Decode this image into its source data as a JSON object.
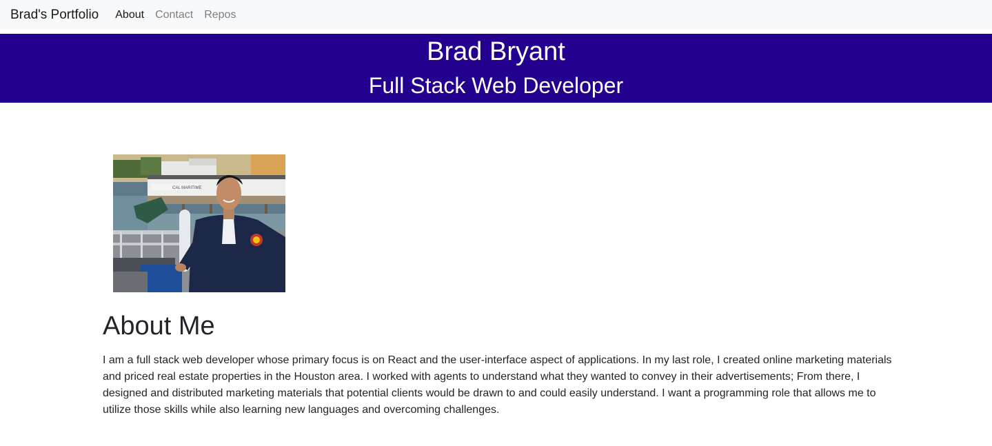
{
  "navbar": {
    "brand": "Brad's Portfolio",
    "links": [
      "About",
      "Contact",
      "Repos"
    ],
    "active": "About"
  },
  "hero": {
    "name": "Brad Bryant",
    "title": "Full Stack Web Developer",
    "background_color": "#24008f"
  },
  "photo": {
    "sign_text": "CAL MARITIME"
  },
  "about": {
    "heading": "About Me",
    "body": "I am a full stack web developer whose primary focus is on React and the user-interface aspect of applications. In my last role, I created online marketing materials and priced real estate properties in the Houston area. I worked with agents to understand what they wanted to convey in their advertisements; From there, I designed and distributed marketing materials that potential clients would be drawn to and could easily understand. I want a programming role that allows me to utilize those skills while also learning new languages and overcoming challenges."
  }
}
